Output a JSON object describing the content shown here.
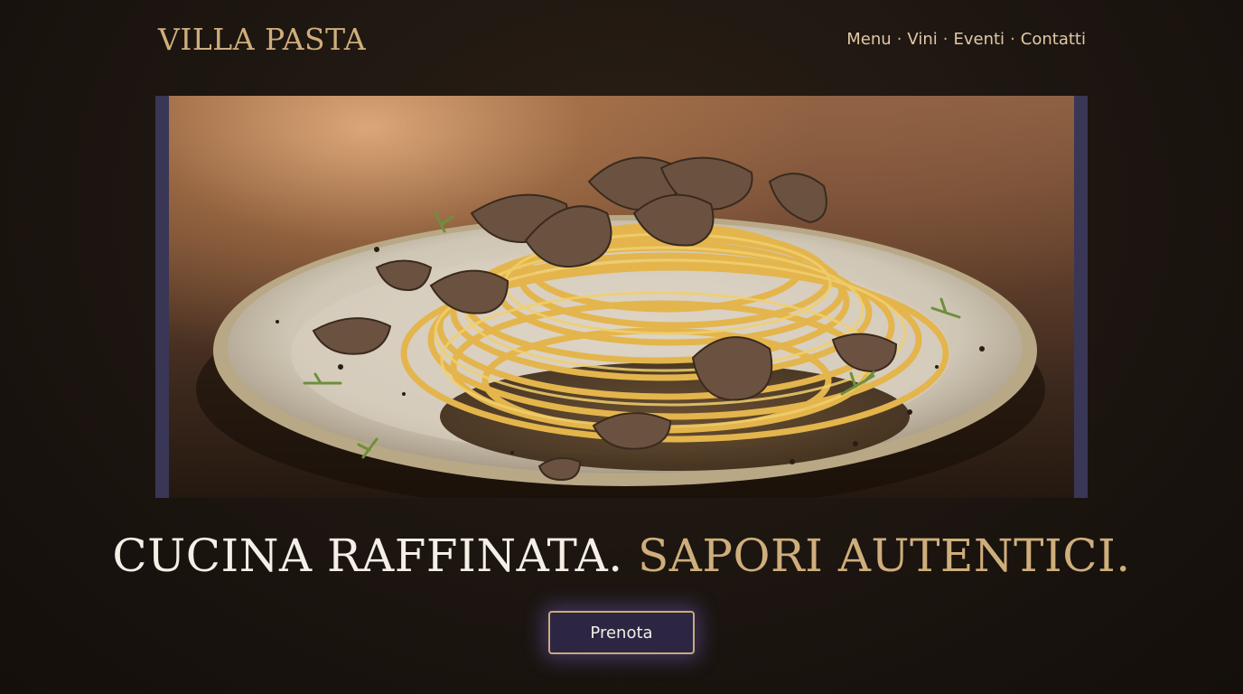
{
  "brand": {
    "name": "VILLA PASTA"
  },
  "nav": {
    "items": [
      {
        "label": "Menu"
      },
      {
        "label": "Vini"
      },
      {
        "label": "Eventi"
      },
      {
        "label": "Contatti"
      }
    ],
    "separator": "·"
  },
  "hero": {
    "image_icon": "truffle-pasta-photo"
  },
  "headline": {
    "part1": "CUCINA RAFFINATA.",
    "part2": "SAPORI AUTENTICI."
  },
  "cta": {
    "label": "Prenota"
  },
  "colors": {
    "background": "#1c1510",
    "accent_gold": "#cfae7c",
    "headline_white": "#f5efe6",
    "frame_purple": "#3a3656",
    "button_glow": "#6e5fbe"
  }
}
